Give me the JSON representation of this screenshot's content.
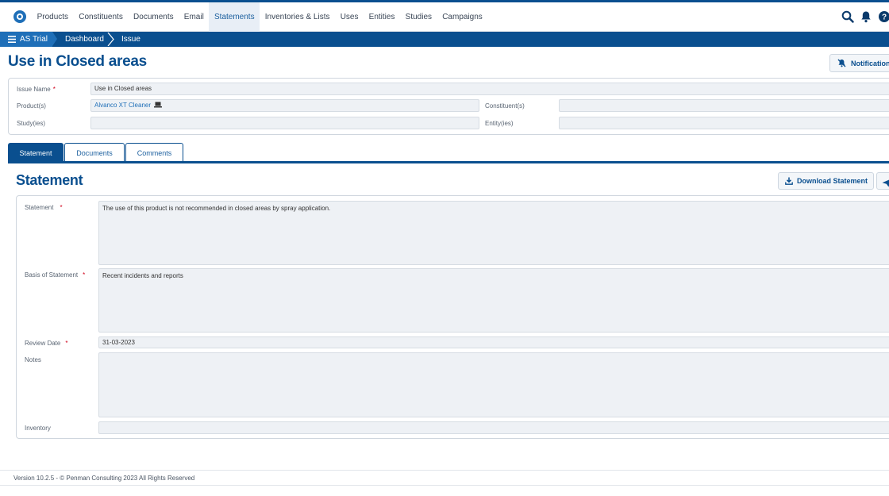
{
  "nav": {
    "items": [
      "Products",
      "Constituents",
      "Documents",
      "Email",
      "Statements",
      "Inventories & Lists",
      "Uses",
      "Entities",
      "Studies",
      "Campaigns"
    ],
    "active": "Statements"
  },
  "breadcrumb": {
    "first": "AS Trial",
    "second": "Dashboard",
    "third": "Issue"
  },
  "header": {
    "title": "Use in Closed areas",
    "notifications_label": "Notifications"
  },
  "issue": {
    "name_label": "Issue Name",
    "name_value": "Use in Closed areas",
    "products_label": "Product(s)",
    "products_value": "Alvanco XT Cleaner",
    "constituents_label": "Constituent(s)",
    "constituents_value": "",
    "studies_label": "Study(ies)",
    "studies_value": "",
    "entities_label": "Entity(ies)",
    "entities_value": ""
  },
  "tabs": [
    "Statement",
    "Documents",
    "Comments"
  ],
  "statement": {
    "title": "Statement",
    "download_label": "Download Statement",
    "statement_label": "Statement",
    "statement_value": "The use of this product is not recommended in closed areas by spray application.",
    "basis_label": "Basis of Statement",
    "basis_value": "Recent incidents and reports",
    "review_label": "Review Date",
    "review_value": "31-03-2023",
    "notes_label": "Notes",
    "notes_value": "",
    "inventory_label": "Inventory",
    "inventory_value": ""
  },
  "footer": {
    "text": "Version 10.2.5 - © Penman Consulting 2023 All Rights Reserved"
  },
  "colors": {
    "primary": "#0a4f8f",
    "accent": "#1f6fb8",
    "required": "#d0021b",
    "field_bg": "#eef1f5"
  }
}
